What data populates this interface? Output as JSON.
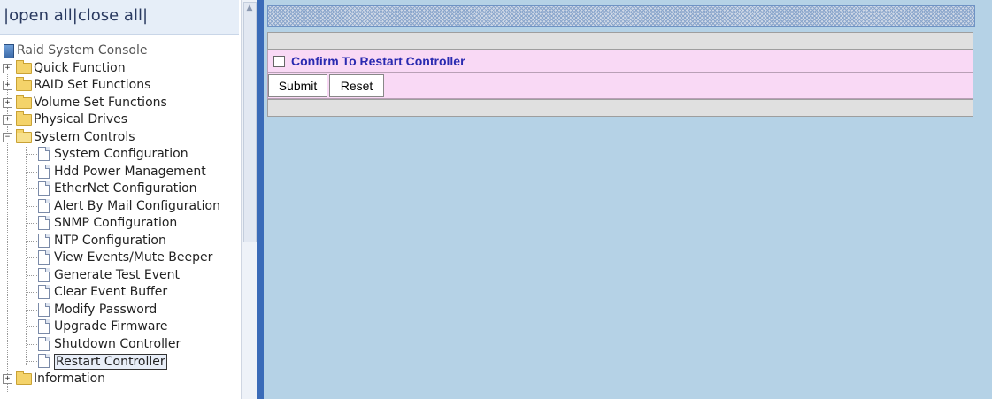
{
  "left_frame": {
    "open_close": {
      "prefix": "|",
      "open_all": "open all",
      "sep": "|",
      "close_all": "close all",
      "suffix": "|"
    },
    "root": "Raid System Console",
    "folders": [
      {
        "label": "Quick Function",
        "toggle": "+"
      },
      {
        "label": "RAID Set Functions",
        "toggle": "+"
      },
      {
        "label": "Volume Set Functions",
        "toggle": "+"
      },
      {
        "label": "Physical Drives",
        "toggle": "+"
      },
      {
        "label": "System Controls",
        "toggle": "−"
      }
    ],
    "system_controls_items": [
      "System Configuration",
      "Hdd Power Management",
      "EtherNet Configuration",
      "Alert By Mail Configuration",
      "SNMP Configuration",
      "NTP Configuration",
      "View Events/Mute Beeper",
      "Generate Test Event",
      "Clear Event Buffer",
      "Modify Password",
      "Upgrade Firmware",
      "Shutdown Controller",
      "Restart Controller"
    ],
    "selected_item": "Restart Controller",
    "last_folder": {
      "label": "Information",
      "toggle": "+"
    }
  },
  "main": {
    "confirm_label": "Confirm To Restart Controller",
    "confirm_checked": false,
    "submit_label": "Submit",
    "reset_label": "Reset"
  },
  "colors": {
    "main_bg": "#b5d2e6",
    "divider": "#3a6bb8",
    "pink_row": "#f9d9f5",
    "confirm_text": "#2a2ab0"
  }
}
